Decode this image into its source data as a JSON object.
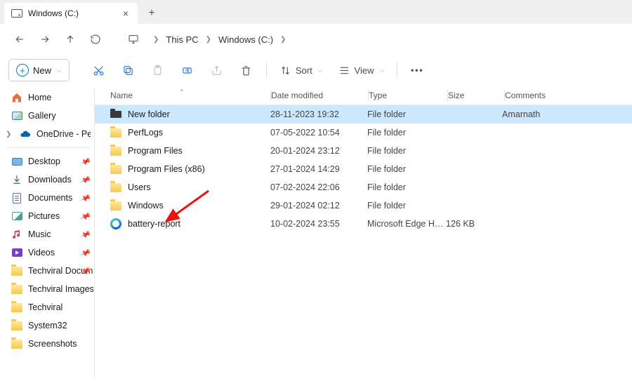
{
  "tab": {
    "title": "Windows (C:)"
  },
  "breadcrumbs": [
    "This PC",
    "Windows (C:)"
  ],
  "toolbar": {
    "new": "New",
    "sort": "Sort",
    "view": "View"
  },
  "columns": {
    "name": "Name",
    "date": "Date modified",
    "type": "Type",
    "size": "Size",
    "comments": "Comments"
  },
  "sidebar": {
    "home": "Home",
    "gallery": "Gallery",
    "onedrive": "OneDrive - Persona",
    "desktop": "Desktop",
    "downloads": "Downloads",
    "documents": "Documents",
    "pictures": "Pictures",
    "music": "Music",
    "videos": "Videos",
    "techviral_docum": "Techviral Docum",
    "techviral_images": "Techviral Images",
    "techviral": "Techviral",
    "system32": "System32",
    "screenshots": "Screenshots"
  },
  "rows": [
    {
      "name": "New folder",
      "date": "28-11-2023 19:32",
      "type": "File folder",
      "size": "",
      "comments": "Amarnath",
      "icon": "folder-dark",
      "selected": true
    },
    {
      "name": "PerfLogs",
      "date": "07-05-2022 10:54",
      "type": "File folder",
      "size": "",
      "comments": "",
      "icon": "folder"
    },
    {
      "name": "Program Files",
      "date": "20-01-2024 23:12",
      "type": "File folder",
      "size": "",
      "comments": "",
      "icon": "folder"
    },
    {
      "name": "Program Files (x86)",
      "date": "27-01-2024 14:29",
      "type": "File folder",
      "size": "",
      "comments": "",
      "icon": "folder"
    },
    {
      "name": "Users",
      "date": "07-02-2024 22:06",
      "type": "File folder",
      "size": "",
      "comments": "",
      "icon": "folder"
    },
    {
      "name": "Windows",
      "date": "29-01-2024 02:12",
      "type": "File folder",
      "size": "",
      "comments": "",
      "icon": "folder"
    },
    {
      "name": "battery-report",
      "date": "10-02-2024 23:55",
      "type": "Microsoft Edge HTM...",
      "size": "126 KB",
      "comments": "",
      "icon": "edge"
    }
  ]
}
